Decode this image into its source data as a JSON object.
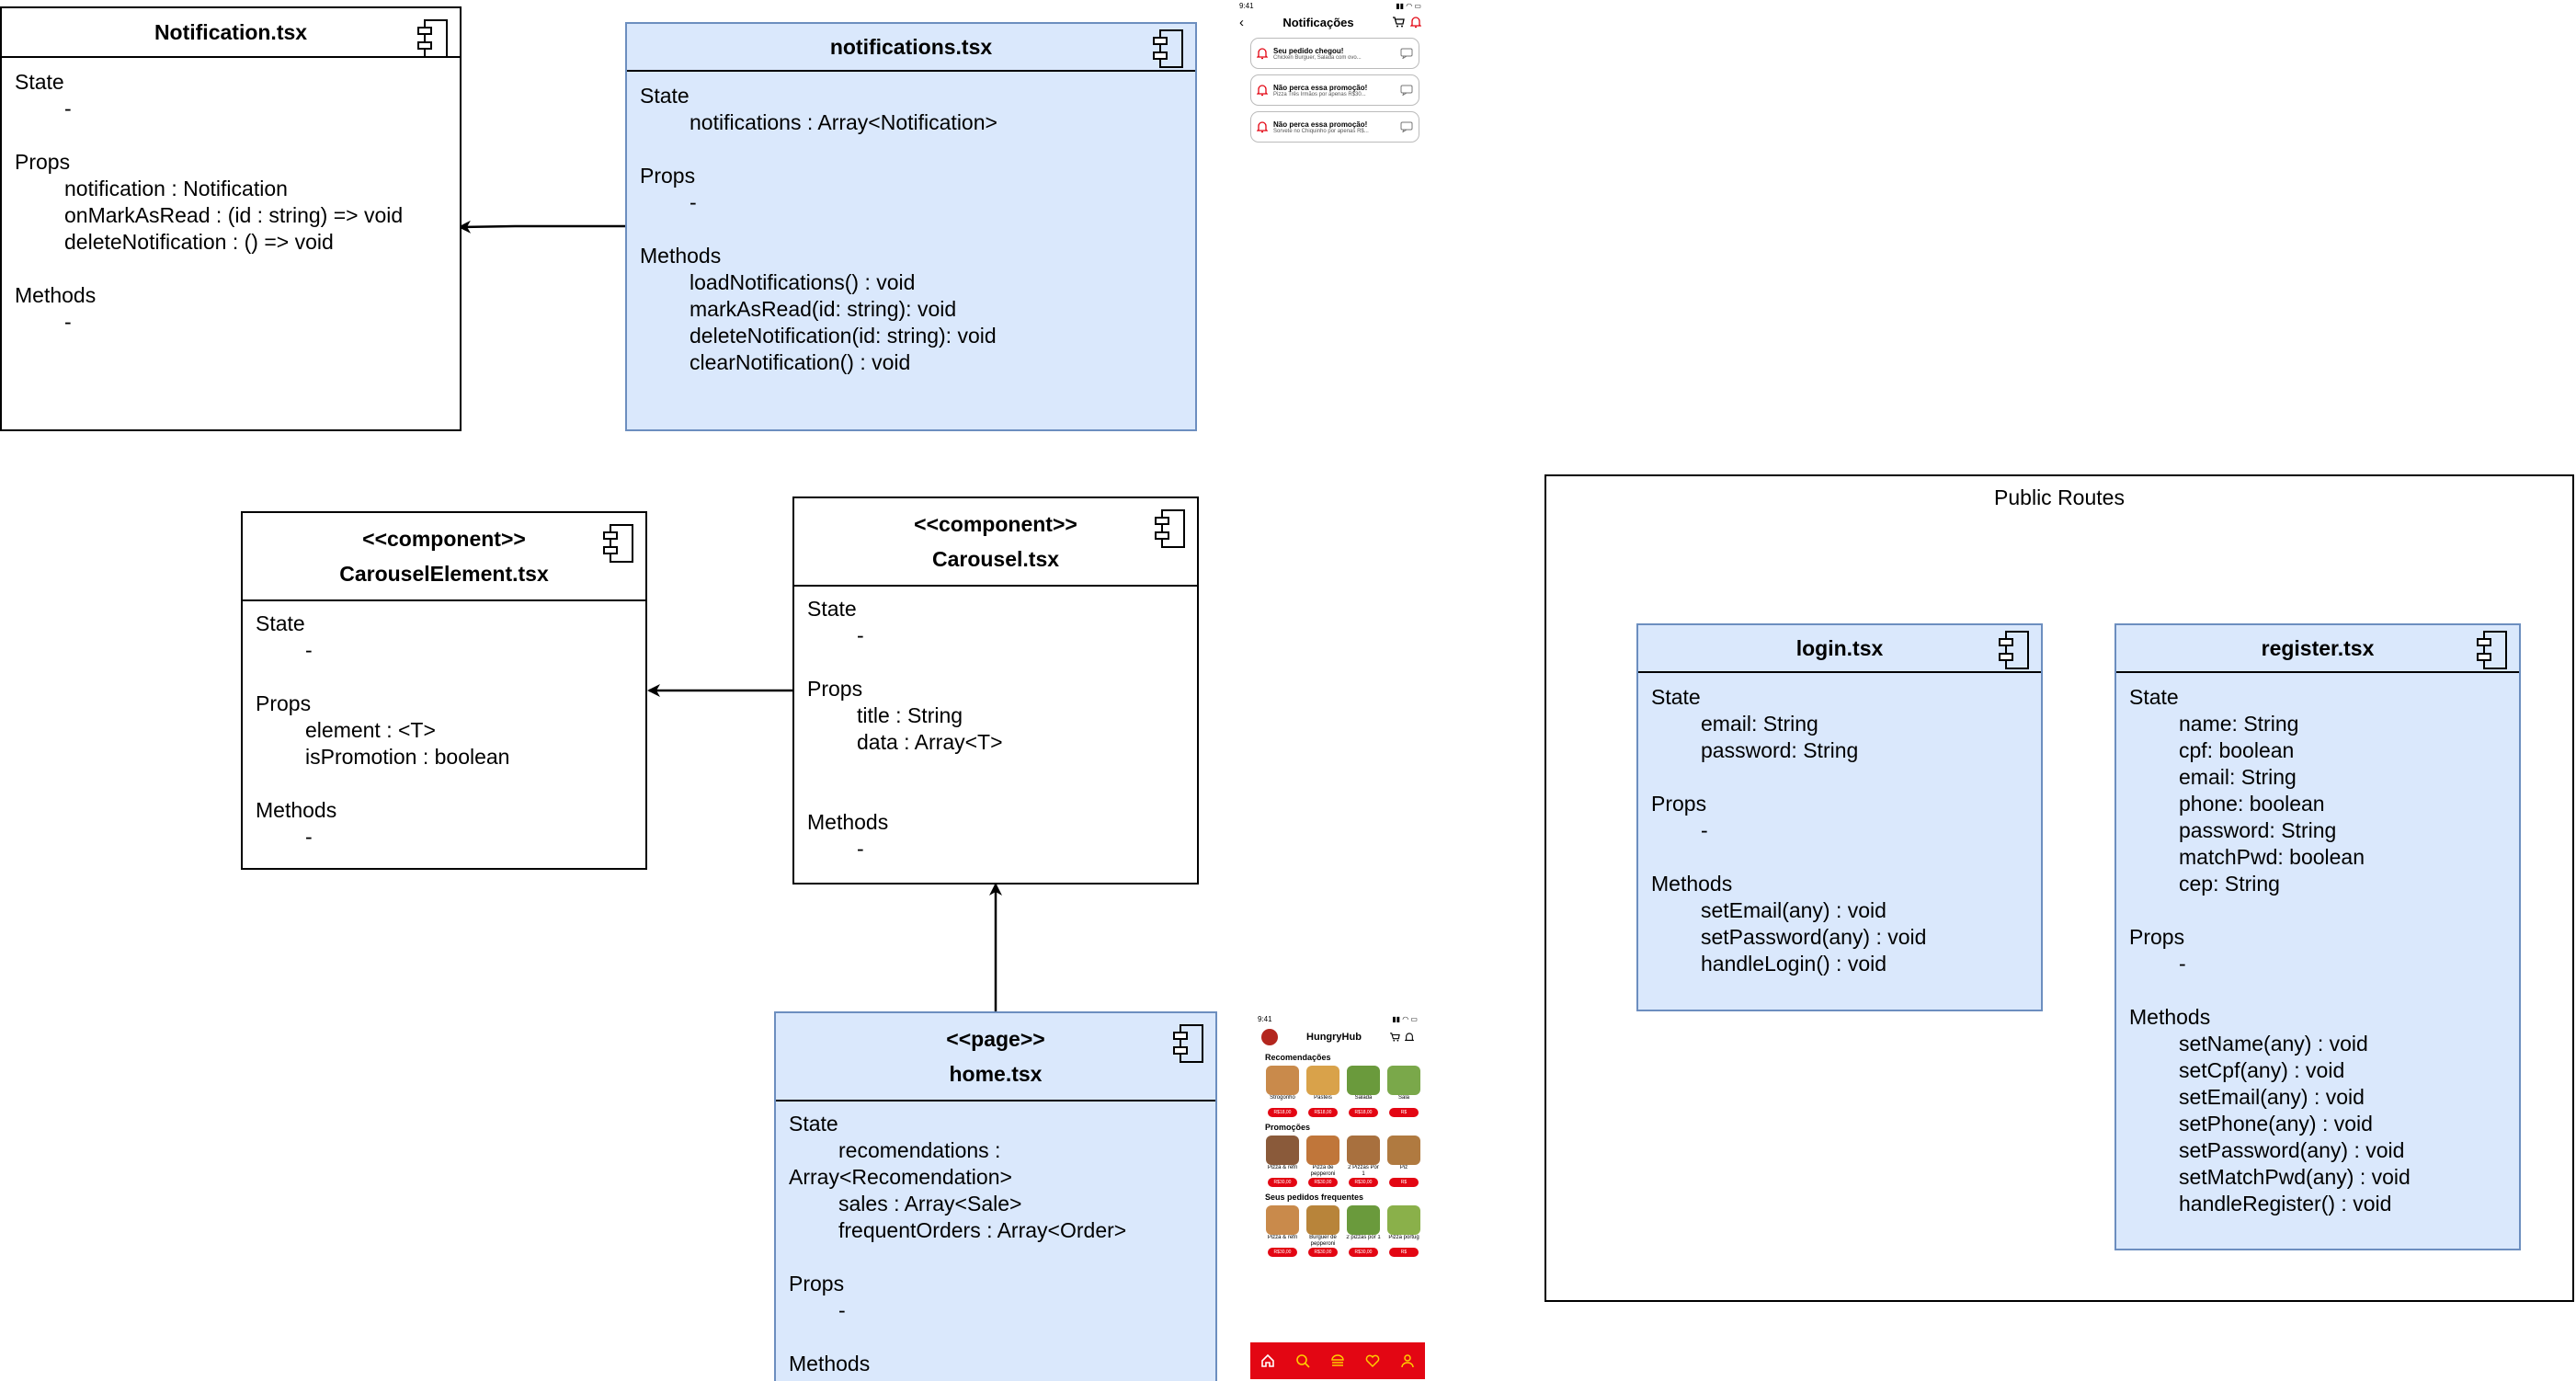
{
  "notification_comp": {
    "title": "Notification.tsx",
    "lines": [
      "State",
      "-",
      "",
      "Props",
      "notification : Notification",
      "onMarkAsRead : (id : string) => void",
      "deleteNotification : () => void",
      "",
      "Methods",
      "-"
    ]
  },
  "notifications_page": {
    "title": "notifications.tsx",
    "lines": [
      "State",
      "notifications : Array<Notification>",
      "",
      "Props",
      "-",
      "",
      "Methods",
      "loadNotifications() : void",
      "markAsRead(id: string): void",
      "deleteNotification(id: string): void",
      "clearNotification() : void"
    ]
  },
  "carousel_element": {
    "stereotype": "<<component>>",
    "title": "CarouselElement.tsx",
    "lines": [
      "State",
      "-",
      "",
      "Props",
      "element : <T>",
      "isPromotion : boolean",
      "",
      "Methods",
      "-"
    ]
  },
  "carousel": {
    "stereotype": "<<component>>",
    "title": "Carousel.tsx",
    "lines": [
      "State",
      "-",
      "",
      "Props",
      "title : String",
      "data : Array<T>",
      "",
      "",
      "Methods",
      "-"
    ]
  },
  "home": {
    "stereotype": "<<page>>",
    "title": "home.tsx",
    "lines": [
      "State",
      "recomendations :",
      "Array<Recomendation>",
      "sales : Array<Sale>",
      "frequentOrders : Array<Order>",
      "",
      "Props",
      "-",
      "",
      "Methods"
    ]
  },
  "public_routes": {
    "title": "Public Routes"
  },
  "login": {
    "title": "login.tsx",
    "lines": [
      "State",
      "email: String",
      "password: String",
      "",
      "Props",
      "-",
      "",
      "Methods",
      "setEmail(any) : void",
      "setPassword(any) : void",
      "handleLogin() : void"
    ]
  },
  "register": {
    "title": "register.tsx",
    "lines": [
      "State",
      "name: String",
      "cpf: boolean",
      "email: String",
      "phone: boolean",
      "password: String",
      "matchPwd: boolean",
      "cep: String",
      "",
      "Props",
      "-",
      "",
      "Methods",
      "setName(any) : void",
      "setCpf(any) : void",
      "setEmail(any) : void",
      "setPhone(any) : void",
      "setPassword(any) : void",
      "setMatchPwd(any) : void",
      "handleRegister() : void"
    ]
  },
  "phone_notifications": {
    "time": "9:41",
    "title": "Notificações",
    "cards": [
      {
        "title": "Seu pedido chegou!",
        "text": "Chicken Burguer, Salada com ovo..."
      },
      {
        "title": "Não perca essa promoção!",
        "text": "Pizza Três Irmãos por apenas R$30..."
      },
      {
        "title": "Não perca essa promoção!",
        "text": "Sorvete no Chiquinho por apenas R$..."
      }
    ]
  },
  "phone_home": {
    "time": "9:41",
    "app_name": "HungryHub",
    "sections": [
      {
        "title": "Recomendações",
        "items": [
          {
            "name": "Strogonho",
            "price": "R$18,00",
            "color": "#c98a4b"
          },
          {
            "name": "Pastéis",
            "price": "R$18,00",
            "color": "#d9a24a"
          },
          {
            "name": "Salada",
            "price": "R$18,00",
            "color": "#6a9a3c"
          },
          {
            "name": "Sala",
            "price": "R$",
            "color": "#7aa84a"
          }
        ]
      },
      {
        "title": "Promoções",
        "items": [
          {
            "name": "Pizza & refri",
            "price": "R$30,00",
            "color": "#8a5a3a"
          },
          {
            "name": "Pizza de pepperoni",
            "price": "R$30,00",
            "color": "#c0763a"
          },
          {
            "name": "2 Pizzas Por 1",
            "price": "R$30,00",
            "color": "#a8703e"
          },
          {
            "name": "Piz",
            "price": "R$",
            "color": "#b07a40"
          }
        ]
      },
      {
        "title": "Seus pedidos frequentes",
        "items": [
          {
            "name": "Pizza & refri",
            "price": "R$30,00",
            "color": "#c98a4b"
          },
          {
            "name": "Burguer de pepperoni",
            "price": "R$30,00",
            "color": "#b8843a"
          },
          {
            "name": "2 pizzas por 1",
            "price": "R$30,00",
            "color": "#6a9a3c"
          },
          {
            "name": "Pizza portug",
            "price": "R$",
            "color": "#8ab04a"
          }
        ]
      }
    ],
    "accent": "#e30613"
  },
  "colors": {
    "blue_fill": "#dae8fc",
    "blue_stroke": "#6c8ebf",
    "accent": "#e30613"
  }
}
